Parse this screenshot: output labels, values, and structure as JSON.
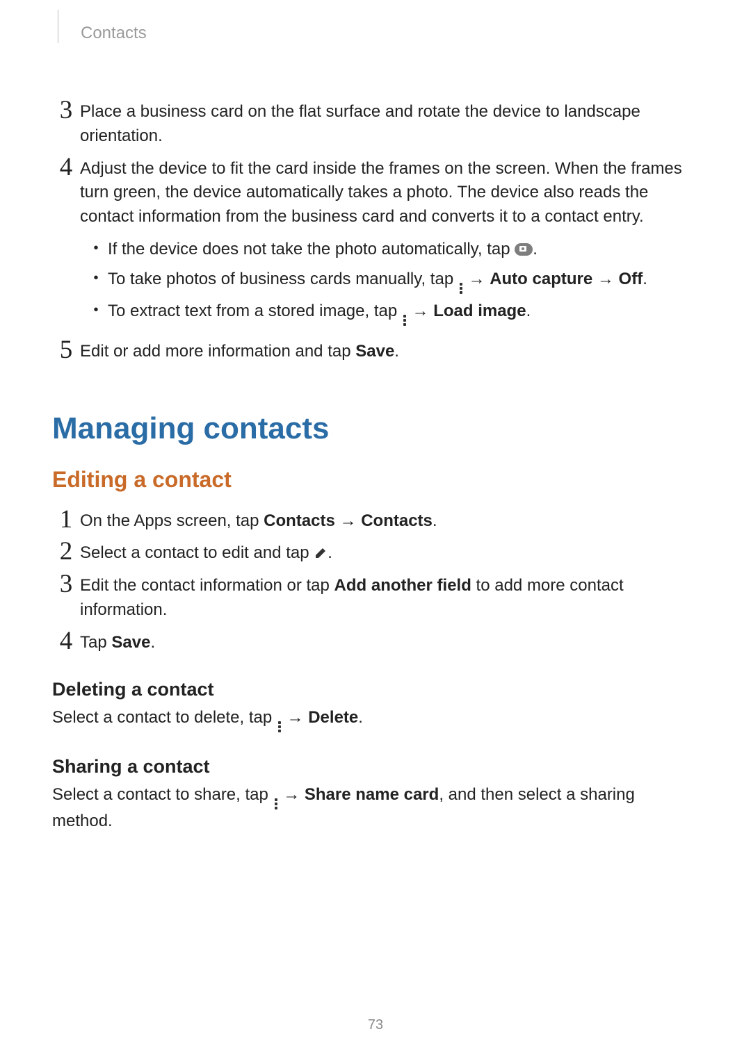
{
  "header": {
    "section": "Contacts"
  },
  "steps_a": {
    "s3": "Place a business card on the flat surface and rotate the device to landscape orientation.",
    "s4": "Adjust the device to fit the card inside the frames on the screen. When the frames turn green, the device automatically takes a photo. The device also reads the contact information from the business card and converts it to a contact entry.",
    "s4_bullets": {
      "b1_pre": "If the device does not take the photo automatically, tap ",
      "b1_post": ".",
      "b2_pre": "To take photos of business cards manually, tap ",
      "b2_mid1": " → ",
      "b2_bold1": "Auto capture",
      "b2_mid2": " → ",
      "b2_bold2": "Off",
      "b2_post": ".",
      "b3_pre": "To extract text from a stored image, tap ",
      "b3_mid": " → ",
      "b3_bold": "Load image",
      "b3_post": "."
    },
    "s5_pre": "Edit or add more information and tap ",
    "s5_bold": "Save",
    "s5_post": "."
  },
  "h1": "Managing contacts",
  "h2": "Editing a contact",
  "steps_b": {
    "s1_pre": "On the Apps screen, tap ",
    "s1_bold1": "Contacts",
    "s1_mid": " → ",
    "s1_bold2": "Contacts",
    "s1_post": ".",
    "s2_pre": "Select a contact to edit and tap ",
    "s2_post": ".",
    "s3_pre": "Edit the contact information or tap ",
    "s3_bold": "Add another field",
    "s3_post": " to add more contact information.",
    "s4_pre": "Tap ",
    "s4_bold": "Save",
    "s4_post": "."
  },
  "deleting": {
    "heading": "Deleting a contact",
    "pre": "Select a contact to delete, tap ",
    "mid": " → ",
    "bold": "Delete",
    "post": "."
  },
  "sharing": {
    "heading": "Sharing a contact",
    "pre": "Select a contact to share, tap ",
    "mid": " → ",
    "bold": "Share name card",
    "post": ", and then select a sharing method."
  },
  "page_number": "73",
  "nums": {
    "n1": "1",
    "n2": "2",
    "n3": "3",
    "n4": "4",
    "n5": "5"
  }
}
